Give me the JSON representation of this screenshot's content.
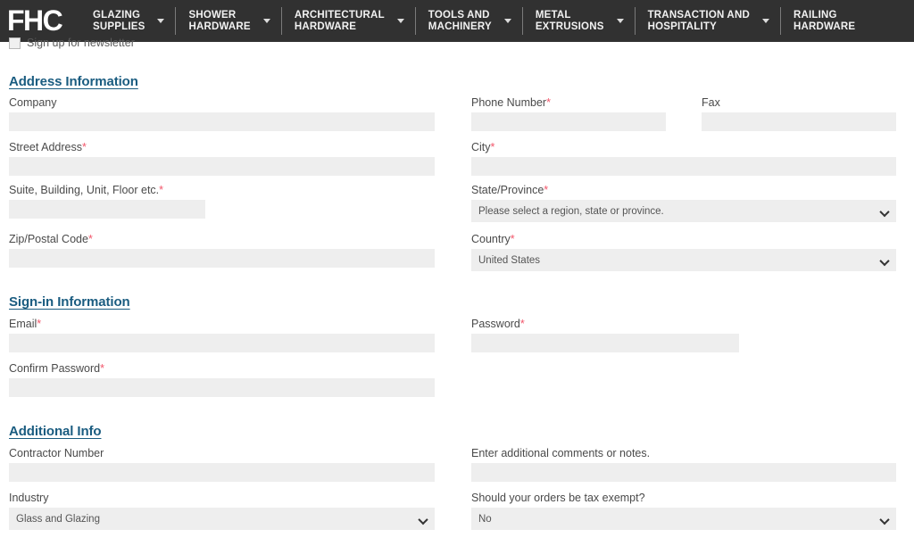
{
  "header": {
    "logo_text": "FHC",
    "nav_items": [
      {
        "label": "GLAZING\nSUPPLIES",
        "caret": "caret-down-icon"
      },
      {
        "label": "SHOWER\nHARDWARE",
        "caret": "caret-down-icon"
      },
      {
        "label": "ARCHITECTURAL\nHARDWARE",
        "caret": "caret-down-icon"
      },
      {
        "label": "TOOLS AND\nMACHINERY",
        "caret": "caret-down-icon"
      },
      {
        "label": "METAL\nEXTRUSIONS",
        "caret": "caret-down-icon"
      },
      {
        "label": "TRANSACTION AND\nHOSPITALITY",
        "caret": "caret-down-icon"
      },
      {
        "label": "RAILING\nHARDWARE",
        "caret": "caret-down-icon"
      }
    ],
    "background_color": "#313131",
    "text_color": "#f2f2f2"
  },
  "clipped_row": {
    "label": "Sign up for newsletter",
    "checked": false
  },
  "sections": {
    "address": {
      "title": "Address Information",
      "fields": {
        "company": {
          "label": "Company",
          "required": false,
          "value": ""
        },
        "phone": {
          "label": "Phone Number",
          "required": true,
          "value": ""
        },
        "fax": {
          "label": "Fax",
          "required": false,
          "value": ""
        },
        "street": {
          "label": "Street Address",
          "required": true,
          "value": ""
        },
        "city": {
          "label": "City",
          "required": true,
          "value": ""
        },
        "suite": {
          "label": "Suite, Building, Unit, Floor etc.",
          "required": true,
          "value": ""
        },
        "state": {
          "label": "State/Province",
          "required": true,
          "value": "Please select a region, state or province."
        },
        "zip": {
          "label": "Zip/Postal Code",
          "required": true,
          "value": ""
        },
        "country": {
          "label": "Country",
          "required": true,
          "value": "United States"
        }
      }
    },
    "signin": {
      "title": "Sign-in Information",
      "fields": {
        "email": {
          "label": "Email",
          "required": true,
          "value": ""
        },
        "password": {
          "label": "Password",
          "required": true,
          "value": ""
        },
        "confirm_password": {
          "label": "Confirm Password",
          "required": true,
          "value": ""
        }
      }
    },
    "additional": {
      "title": "Additional Info",
      "fields": {
        "contractor_number": {
          "label": "Contractor Number",
          "required": false,
          "value": ""
        },
        "comments": {
          "label": "Enter additional comments or notes.",
          "required": false,
          "value": ""
        },
        "industry": {
          "label": "Industry",
          "required": false,
          "value": "Glass and Glazing"
        },
        "tax_exempt": {
          "label": "Should your orders be tax exempt?",
          "required": false,
          "value": "No"
        }
      }
    }
  },
  "colors": {
    "heading": "#1a5c80",
    "required_asterisk": "#f2566a",
    "field_background": "#eeeeee",
    "header_background": "#313131"
  }
}
